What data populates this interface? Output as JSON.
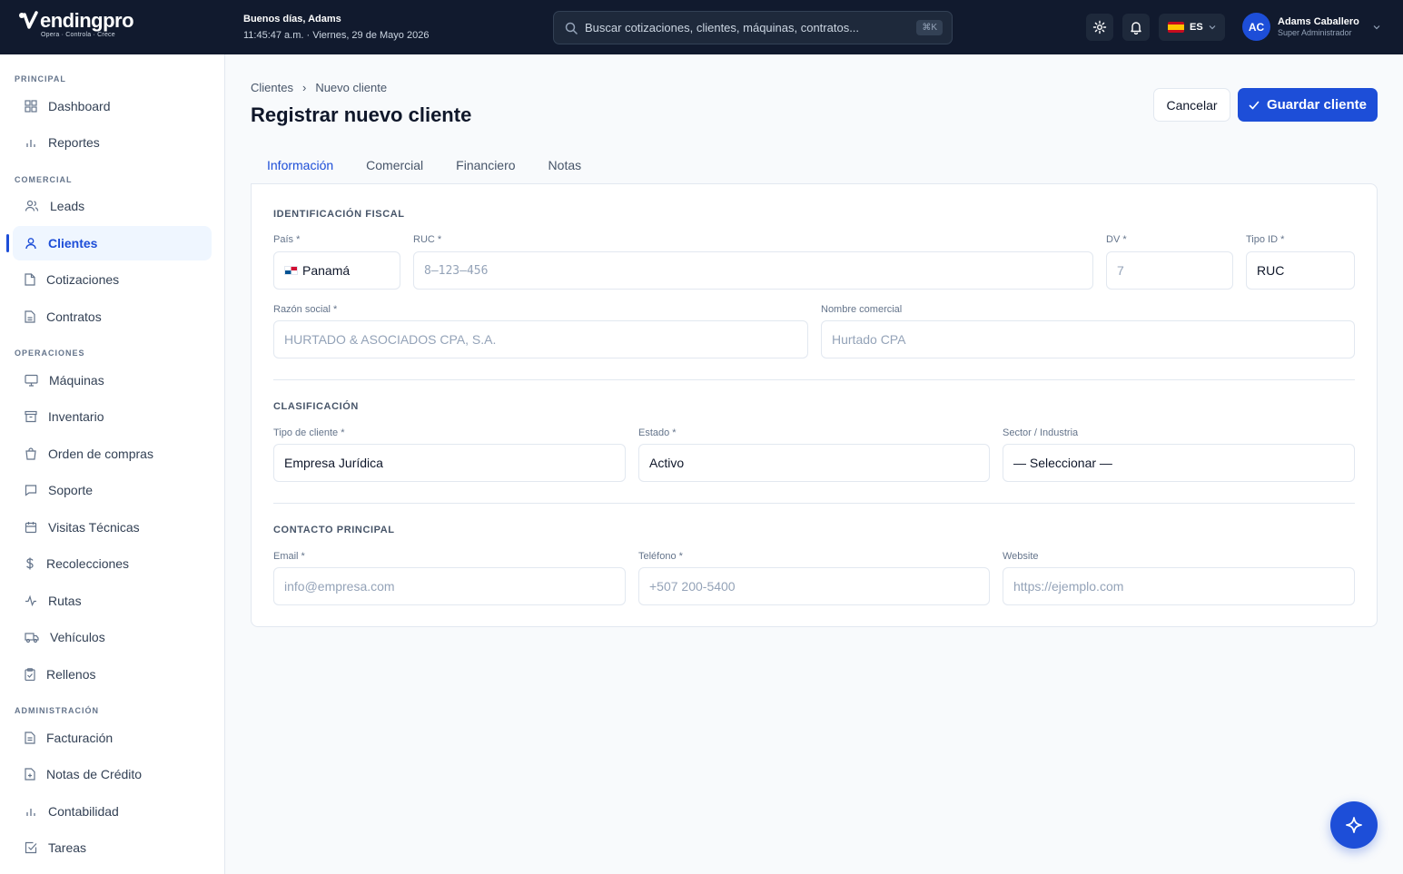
{
  "brand": {
    "name": "endingpro",
    "tagline": "Opera · Controla · Crece"
  },
  "header": {
    "greeting": "Buenos días, Adams",
    "datetime": "11:45:47 a.m. · Viernes, 29 de Mayo 2026",
    "search_placeholder": "Buscar cotizaciones, clientes, máquinas, contratos...",
    "search_shortcut": "⌘K",
    "language": "ES",
    "user": {
      "initials": "AC",
      "name": "Adams Caballero",
      "role": "Super Administrador"
    }
  },
  "sidebar": {
    "sections": [
      {
        "label": "PRINCIPAL",
        "items": [
          "Dashboard",
          "Reportes"
        ]
      },
      {
        "label": "COMERCIAL",
        "items": [
          "Leads",
          "Clientes",
          "Cotizaciones",
          "Contratos"
        ]
      },
      {
        "label": "OPERACIONES",
        "items": [
          "Máquinas",
          "Inventario",
          "Orden de compras",
          "Soporte",
          "Visitas Técnicas",
          "Recolecciones",
          "Rutas",
          "Vehículos",
          "Rellenos"
        ]
      },
      {
        "label": "ADMINISTRACIÓN",
        "items": [
          "Facturación",
          "Notas de Crédito",
          "Contabilidad",
          "Tareas"
        ]
      }
    ],
    "active": "Clientes"
  },
  "page": {
    "breadcrumb": [
      "Clientes",
      "›",
      "Nuevo cliente"
    ],
    "title": "Registrar nuevo cliente",
    "cancel_label": "Cancelar",
    "save_label": "Guardar cliente",
    "tabs": [
      "Información",
      "Comercial",
      "Financiero",
      "Notas"
    ],
    "active_tab": "Información"
  },
  "form": {
    "fiscal": {
      "title": "IDENTIFICACIÓN FISCAL",
      "pais_label": "País *",
      "pais_value": "Panamá",
      "ruc_label": "RUC *",
      "ruc_placeholder": "8–123–456",
      "dv_label": "DV *",
      "dv_placeholder": "7",
      "tipo_id_label": "Tipo ID *",
      "tipo_id_value": "RUC",
      "razon_label": "Razón social *",
      "razon_placeholder": "HURTADO & ASOCIADOS CPA, S.A.",
      "nombre_label": "Nombre comercial",
      "nombre_placeholder": "Hurtado CPA"
    },
    "clasificacion": {
      "title": "CLASIFICACIÓN",
      "tipo_label": "Tipo de cliente *",
      "tipo_value": "Empresa Jurídica",
      "estado_label": "Estado *",
      "estado_value": "Activo",
      "sector_label": "Sector / Industria",
      "sector_value": "— Seleccionar —"
    },
    "contacto": {
      "title": "CONTACTO PRINCIPAL",
      "email_label": "Email *",
      "email_placeholder": "info@empresa.com",
      "telefono_label": "Teléfono *",
      "telefono_placeholder": "+507 200-5400",
      "website_label": "Website",
      "website_placeholder": "https://ejemplo.com"
    }
  },
  "colors": {
    "topbar": "#111a2e",
    "accent": "#1d4ed8",
    "active_bg": "#eff6ff"
  },
  "icons": {
    "fab": "sparkle-icon"
  }
}
